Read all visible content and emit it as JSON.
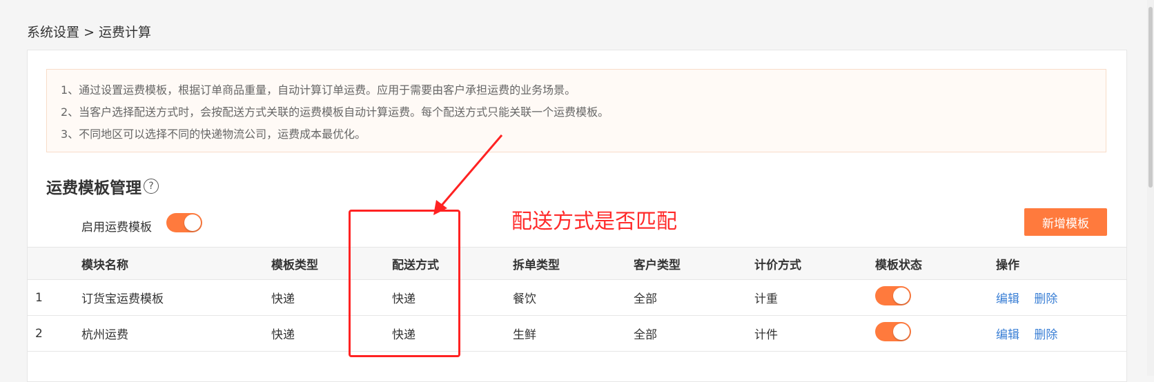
{
  "breadcrumb": {
    "parent": "系统设置",
    "separator": ">",
    "current": "运费计算"
  },
  "notice": {
    "lines": [
      "1、通过设置运费模板，根据订单商品重量，自动计算订单运费。应用于需要由客户承担运费的业务场景。",
      "2、当客户选择配送方式时，会按配送方式关联的运费模板自动计算运费。每个配送方式只能关联一个运费模板。",
      "3、不同地区可以选择不同的快递物流公司，运费成本最优化。"
    ]
  },
  "section": {
    "title": "运费模板管理",
    "help_icon": "question-circle-icon"
  },
  "enable": {
    "label": "启用运费模板",
    "on": true
  },
  "annotation": {
    "text": "配送方式是否匹配",
    "color": "#ff2a2a"
  },
  "add_button": {
    "label": "新增模板"
  },
  "colors": {
    "accent": "#ff7a3d",
    "link": "#3a7fd5",
    "annotation": "#ff2222"
  },
  "table": {
    "headers": [
      "",
      "模块名称",
      "模板类型",
      "配送方式",
      "拆单类型",
      "客户类型",
      "计价方式",
      "模板状态",
      "操作"
    ],
    "rows": [
      {
        "index": "1",
        "name": "订货宝运费模板",
        "type": "快递",
        "delivery": "快递",
        "split": "餐饮",
        "customer": "全部",
        "pricing": "计重",
        "status_on": true,
        "edit": "编辑",
        "delete": "删除"
      },
      {
        "index": "2",
        "name": "杭州运费",
        "type": "快递",
        "delivery": "快递",
        "split": "生鲜",
        "customer": "全部",
        "pricing": "计件",
        "status_on": true,
        "edit": "编辑",
        "delete": "删除"
      }
    ]
  }
}
